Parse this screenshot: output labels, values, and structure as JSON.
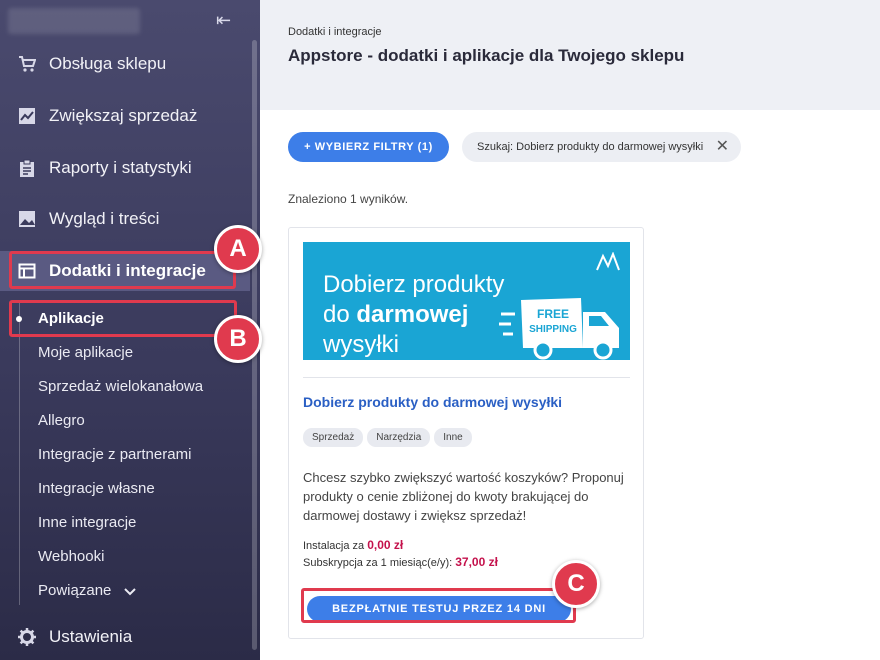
{
  "sidebar": {
    "items": [
      {
        "label": "Obsługa sklepu",
        "icon": "cart-icon"
      },
      {
        "label": "Zwiększaj sprzedaż",
        "icon": "chart-icon"
      },
      {
        "label": "Raporty i statystyki",
        "icon": "clipboard-icon"
      },
      {
        "label": "Wygląd i treści",
        "icon": "image-icon"
      },
      {
        "label": "Dodatki i integracje",
        "icon": "window-icon"
      }
    ],
    "sub_items": [
      "Aplikacje",
      "Moje aplikacje",
      "Sprzedaż wielokanałowa",
      "Allegro",
      "Integracje z partnerami",
      "Integracje własne",
      "Inne integracje",
      "Webhooki",
      "Powiązane"
    ],
    "settings_label": "Ustawienia"
  },
  "annotations": {
    "a": "A",
    "b": "B",
    "c": "C"
  },
  "header": {
    "breadcrumb": "Dodatki i integracje",
    "title": "Appstore - dodatki i aplikacje dla Twojego sklepu"
  },
  "filters": {
    "button_label": "+ WYBIERZ FILTRY (1)",
    "search_chip": "Szukaj: Dobierz produkty do darmowej wysyłki"
  },
  "results_text": "Znaleziono 1 wyników.",
  "card": {
    "banner_line1": "Dobierz produkty",
    "banner_line2_prefix": "do ",
    "banner_line2_bold": "darmowej",
    "banner_line3": "wysyłki",
    "banner_badge_line1": "FREE",
    "banner_badge_line2": "SHIPPING",
    "title": "Dobierz produkty do darmowej wysyłki",
    "tags": [
      "Sprzedaż",
      "Narzędzia",
      "Inne"
    ],
    "description": "Chcesz szybko zwiększyć wartość koszyków? Proponuj produkty o cenie zbliżonej do kwoty brakującej do darmowej dostawy i zwiększ sprzedaż!",
    "install_label": "Instalacja za ",
    "install_price": "0,00 zł",
    "subscription_label": "Subskrypcja za 1 miesiąc(e/y): ",
    "subscription_price": "37,00 zł",
    "trial_button": "BEZPŁATNIE TESTUJ PRZEZ 14 DNI"
  },
  "colors": {
    "accent": "#3d7ee8",
    "highlight": "#e03a4e",
    "price": "#c4124c",
    "sidebar": "#3a3a5c"
  }
}
